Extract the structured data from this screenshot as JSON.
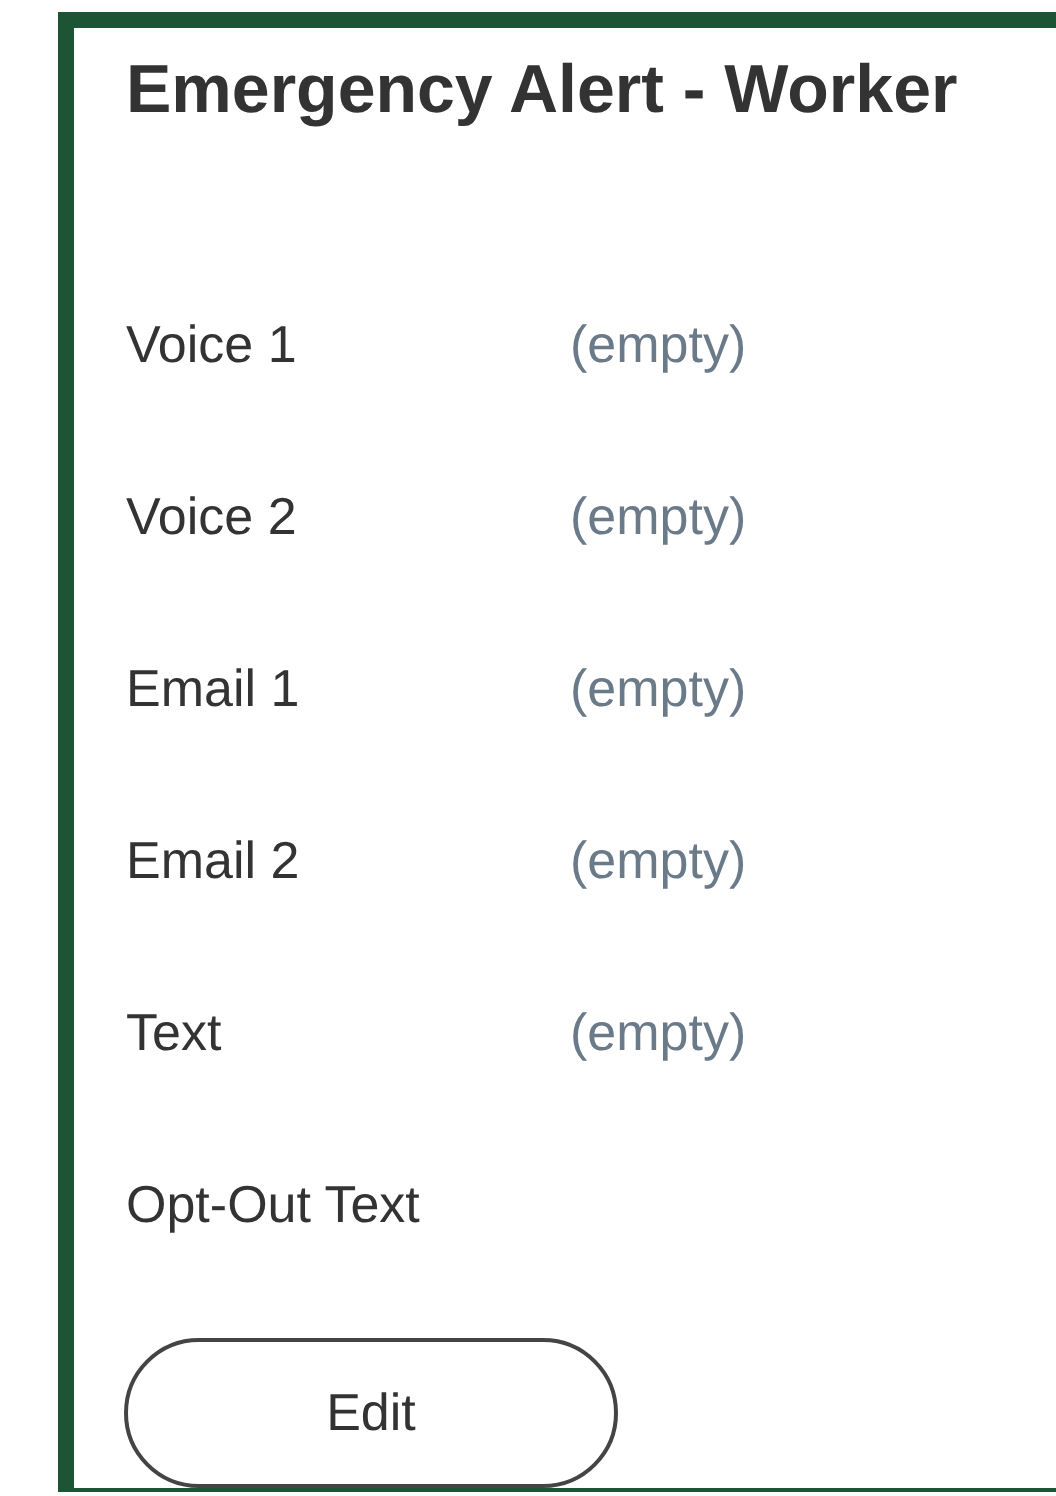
{
  "card": {
    "title": "Emergency Alert - Worker",
    "fields": [
      {
        "label": "Voice 1",
        "value": "(empty)"
      },
      {
        "label": "Voice 2",
        "value": "(empty)"
      },
      {
        "label": "Email 1",
        "value": "(empty)"
      },
      {
        "label": "Email 2",
        "value": "(empty)"
      },
      {
        "label": "Text",
        "value": "(empty)"
      },
      {
        "label": "Opt-Out Text"
      }
    ],
    "button": "Edit"
  }
}
